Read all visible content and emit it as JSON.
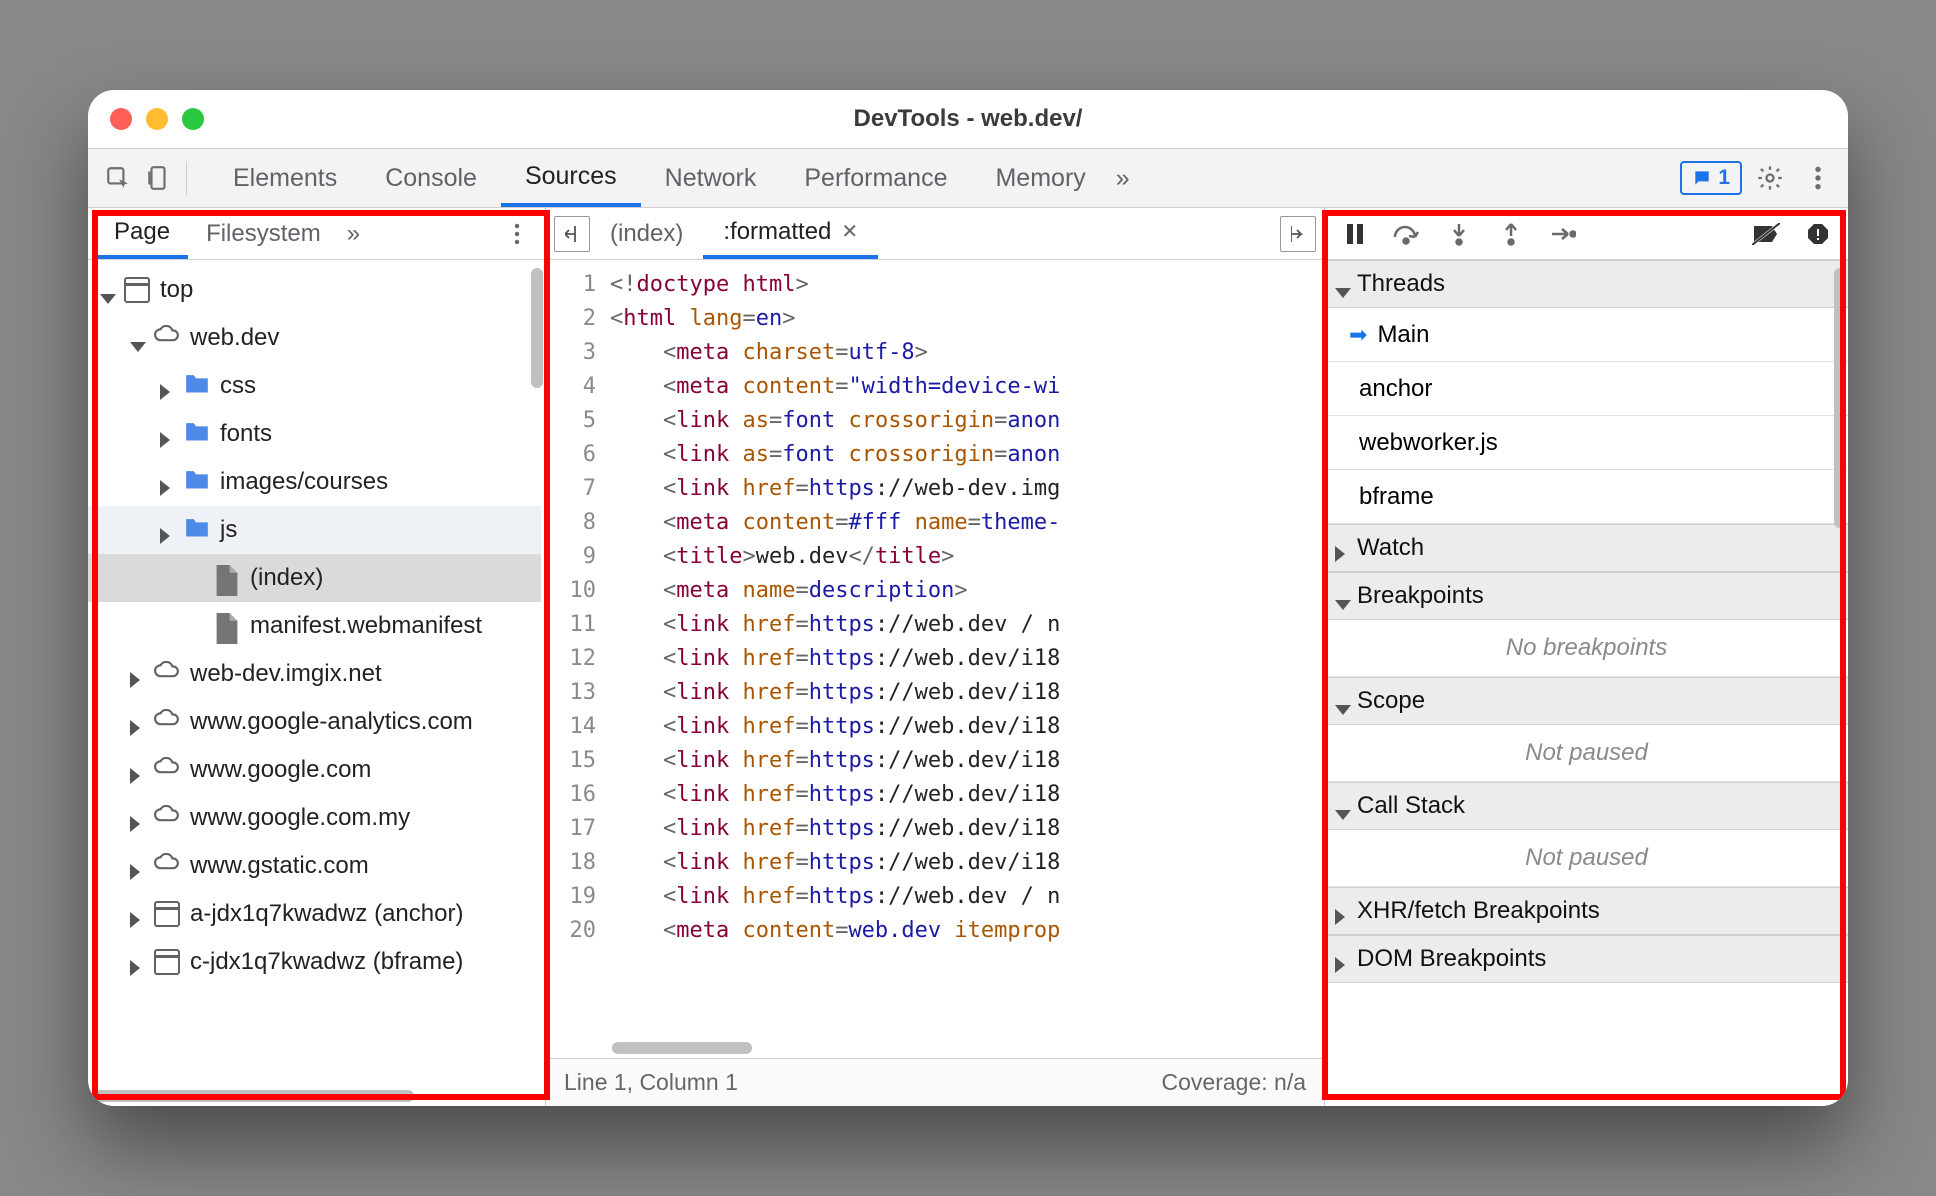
{
  "window": {
    "title": "DevTools - web.dev/"
  },
  "main_tabs": [
    "Elements",
    "Console",
    "Sources",
    "Network",
    "Performance",
    "Memory"
  ],
  "main_tabs_active": "Sources",
  "message_count": "1",
  "navigator": {
    "tabs": [
      "Page",
      "Filesystem"
    ],
    "active_tab": "Page",
    "tree": [
      {
        "depth": 0,
        "disc": "open",
        "icon": "window",
        "label": "top"
      },
      {
        "depth": 1,
        "disc": "open",
        "icon": "cloud",
        "label": "web.dev"
      },
      {
        "depth": 2,
        "disc": "closed",
        "icon": "folder",
        "label": "css"
      },
      {
        "depth": 2,
        "disc": "closed",
        "icon": "folder",
        "label": "fonts"
      },
      {
        "depth": 2,
        "disc": "closed",
        "icon": "folder",
        "label": "images/courses"
      },
      {
        "depth": 2,
        "disc": "closed",
        "icon": "folder",
        "label": "js",
        "class": "hover-light"
      },
      {
        "depth": 3,
        "disc": "none",
        "icon": "file",
        "label": "(index)",
        "class": "selected"
      },
      {
        "depth": 3,
        "disc": "none",
        "icon": "file",
        "label": "manifest.webmanifest"
      },
      {
        "depth": 1,
        "disc": "closed",
        "icon": "cloud",
        "label": "web-dev.imgix.net"
      },
      {
        "depth": 1,
        "disc": "closed",
        "icon": "cloud",
        "label": "www.google-analytics.com"
      },
      {
        "depth": 1,
        "disc": "closed",
        "icon": "cloud",
        "label": "www.google.com"
      },
      {
        "depth": 1,
        "disc": "closed",
        "icon": "cloud",
        "label": "www.google.com.my"
      },
      {
        "depth": 1,
        "disc": "closed",
        "icon": "cloud",
        "label": "www.gstatic.com"
      },
      {
        "depth": 1,
        "disc": "closed",
        "icon": "window",
        "label": "a-jdx1q7kwadwz (anchor)"
      },
      {
        "depth": 1,
        "disc": "closed",
        "icon": "window",
        "label": "c-jdx1q7kwadwz (bframe)"
      }
    ]
  },
  "editor": {
    "tabs": [
      {
        "label": "(index)",
        "active": false
      },
      {
        "label": ":formatted",
        "active": true,
        "closeable": true
      }
    ],
    "gutter_lines": 20,
    "status_left": "Line 1, Column 1",
    "status_right": "Coverage: n/a",
    "code_lines": [
      [
        [
          "punc",
          "<!"
        ],
        [
          "tag",
          "doctype html"
        ],
        [
          "punc",
          ">"
        ]
      ],
      [
        [
          "punc",
          "<"
        ],
        [
          "tag",
          "html "
        ],
        [
          "attr",
          "lang"
        ],
        [
          "punc",
          "="
        ],
        [
          "val",
          "en"
        ],
        [
          "punc",
          ">"
        ]
      ],
      [
        [
          "txt",
          "    "
        ],
        [
          "punc",
          "<"
        ],
        [
          "tag",
          "meta "
        ],
        [
          "attr",
          "charset"
        ],
        [
          "punc",
          "="
        ],
        [
          "val",
          "utf-8"
        ],
        [
          "punc",
          ">"
        ]
      ],
      [
        [
          "txt",
          "    "
        ],
        [
          "punc",
          "<"
        ],
        [
          "tag",
          "meta "
        ],
        [
          "attr",
          "content"
        ],
        [
          "punc",
          "="
        ],
        [
          "val",
          "\"width=device-wi"
        ]
      ],
      [
        [
          "txt",
          "    "
        ],
        [
          "punc",
          "<"
        ],
        [
          "tag",
          "link "
        ],
        [
          "attr",
          "as"
        ],
        [
          "punc",
          "="
        ],
        [
          "val",
          "font "
        ],
        [
          "attr",
          "crossorigin"
        ],
        [
          "punc",
          "="
        ],
        [
          "val",
          "anon"
        ]
      ],
      [
        [
          "txt",
          "    "
        ],
        [
          "punc",
          "<"
        ],
        [
          "tag",
          "link "
        ],
        [
          "attr",
          "as"
        ],
        [
          "punc",
          "="
        ],
        [
          "val",
          "font "
        ],
        [
          "attr",
          "crossorigin"
        ],
        [
          "punc",
          "="
        ],
        [
          "val",
          "anon"
        ]
      ],
      [
        [
          "txt",
          "    "
        ],
        [
          "punc",
          "<"
        ],
        [
          "tag",
          "link "
        ],
        [
          "attr",
          "href"
        ],
        [
          "punc",
          "="
        ],
        [
          "val",
          "https"
        ],
        [
          "txt",
          "://web-dev.img"
        ]
      ],
      [
        [
          "txt",
          "    "
        ],
        [
          "punc",
          "<"
        ],
        [
          "tag",
          "meta "
        ],
        [
          "attr",
          "content"
        ],
        [
          "punc",
          "="
        ],
        [
          "val",
          "#fff "
        ],
        [
          "attr",
          "name"
        ],
        [
          "punc",
          "="
        ],
        [
          "val",
          "theme-"
        ]
      ],
      [
        [
          "txt",
          "    "
        ],
        [
          "punc",
          "<"
        ],
        [
          "tag",
          "title"
        ],
        [
          "punc",
          ">"
        ],
        [
          "txt",
          "web.dev"
        ],
        [
          "punc",
          "</"
        ],
        [
          "tag",
          "title"
        ],
        [
          "punc",
          ">"
        ]
      ],
      [
        [
          "txt",
          "    "
        ],
        [
          "punc",
          "<"
        ],
        [
          "tag",
          "meta "
        ],
        [
          "attr",
          "name"
        ],
        [
          "punc",
          "="
        ],
        [
          "val",
          "description"
        ],
        [
          "punc",
          ">"
        ]
      ],
      [
        [
          "txt",
          "    "
        ],
        [
          "punc",
          "<"
        ],
        [
          "tag",
          "link "
        ],
        [
          "attr",
          "href"
        ],
        [
          "punc",
          "="
        ],
        [
          "val",
          "https"
        ],
        [
          "txt",
          "://web.dev / n"
        ]
      ],
      [
        [
          "txt",
          "    "
        ],
        [
          "punc",
          "<"
        ],
        [
          "tag",
          "link "
        ],
        [
          "attr",
          "href"
        ],
        [
          "punc",
          "="
        ],
        [
          "val",
          "https"
        ],
        [
          "txt",
          "://web.dev/i18"
        ]
      ],
      [
        [
          "txt",
          "    "
        ],
        [
          "punc",
          "<"
        ],
        [
          "tag",
          "link "
        ],
        [
          "attr",
          "href"
        ],
        [
          "punc",
          "="
        ],
        [
          "val",
          "https"
        ],
        [
          "txt",
          "://web.dev/i18"
        ]
      ],
      [
        [
          "txt",
          "    "
        ],
        [
          "punc",
          "<"
        ],
        [
          "tag",
          "link "
        ],
        [
          "attr",
          "href"
        ],
        [
          "punc",
          "="
        ],
        [
          "val",
          "https"
        ],
        [
          "txt",
          "://web.dev/i18"
        ]
      ],
      [
        [
          "txt",
          "    "
        ],
        [
          "punc",
          "<"
        ],
        [
          "tag",
          "link "
        ],
        [
          "attr",
          "href"
        ],
        [
          "punc",
          "="
        ],
        [
          "val",
          "https"
        ],
        [
          "txt",
          "://web.dev/i18"
        ]
      ],
      [
        [
          "txt",
          "    "
        ],
        [
          "punc",
          "<"
        ],
        [
          "tag",
          "link "
        ],
        [
          "attr",
          "href"
        ],
        [
          "punc",
          "="
        ],
        [
          "val",
          "https"
        ],
        [
          "txt",
          "://web.dev/i18"
        ]
      ],
      [
        [
          "txt",
          "    "
        ],
        [
          "punc",
          "<"
        ],
        [
          "tag",
          "link "
        ],
        [
          "attr",
          "href"
        ],
        [
          "punc",
          "="
        ],
        [
          "val",
          "https"
        ],
        [
          "txt",
          "://web.dev/i18"
        ]
      ],
      [
        [
          "txt",
          "    "
        ],
        [
          "punc",
          "<"
        ],
        [
          "tag",
          "link "
        ],
        [
          "attr",
          "href"
        ],
        [
          "punc",
          "="
        ],
        [
          "val",
          "https"
        ],
        [
          "txt",
          "://web.dev/i18"
        ]
      ],
      [
        [
          "txt",
          "    "
        ],
        [
          "punc",
          "<"
        ],
        [
          "tag",
          "link "
        ],
        [
          "attr",
          "href"
        ],
        [
          "punc",
          "="
        ],
        [
          "val",
          "https"
        ],
        [
          "txt",
          "://web.dev / n"
        ]
      ],
      [
        [
          "txt",
          "    "
        ],
        [
          "punc",
          "<"
        ],
        [
          "tag",
          "meta "
        ],
        [
          "attr",
          "content"
        ],
        [
          "punc",
          "="
        ],
        [
          "val",
          "web.dev "
        ],
        [
          "attr",
          "itemprop"
        ]
      ]
    ]
  },
  "debugger": {
    "sections": [
      {
        "title": "Threads",
        "open": true,
        "items": [
          "Main",
          "anchor",
          "webworker.js",
          "bframe"
        ],
        "active_item": "Main"
      },
      {
        "title": "Watch",
        "open": false
      },
      {
        "title": "Breakpoints",
        "open": true,
        "placeholder": "No breakpoints"
      },
      {
        "title": "Scope",
        "open": true,
        "placeholder": "Not paused"
      },
      {
        "title": "Call Stack",
        "open": true,
        "placeholder": "Not paused"
      },
      {
        "title": "XHR/fetch Breakpoints",
        "open": false
      },
      {
        "title": "DOM Breakpoints",
        "open": false
      }
    ]
  }
}
